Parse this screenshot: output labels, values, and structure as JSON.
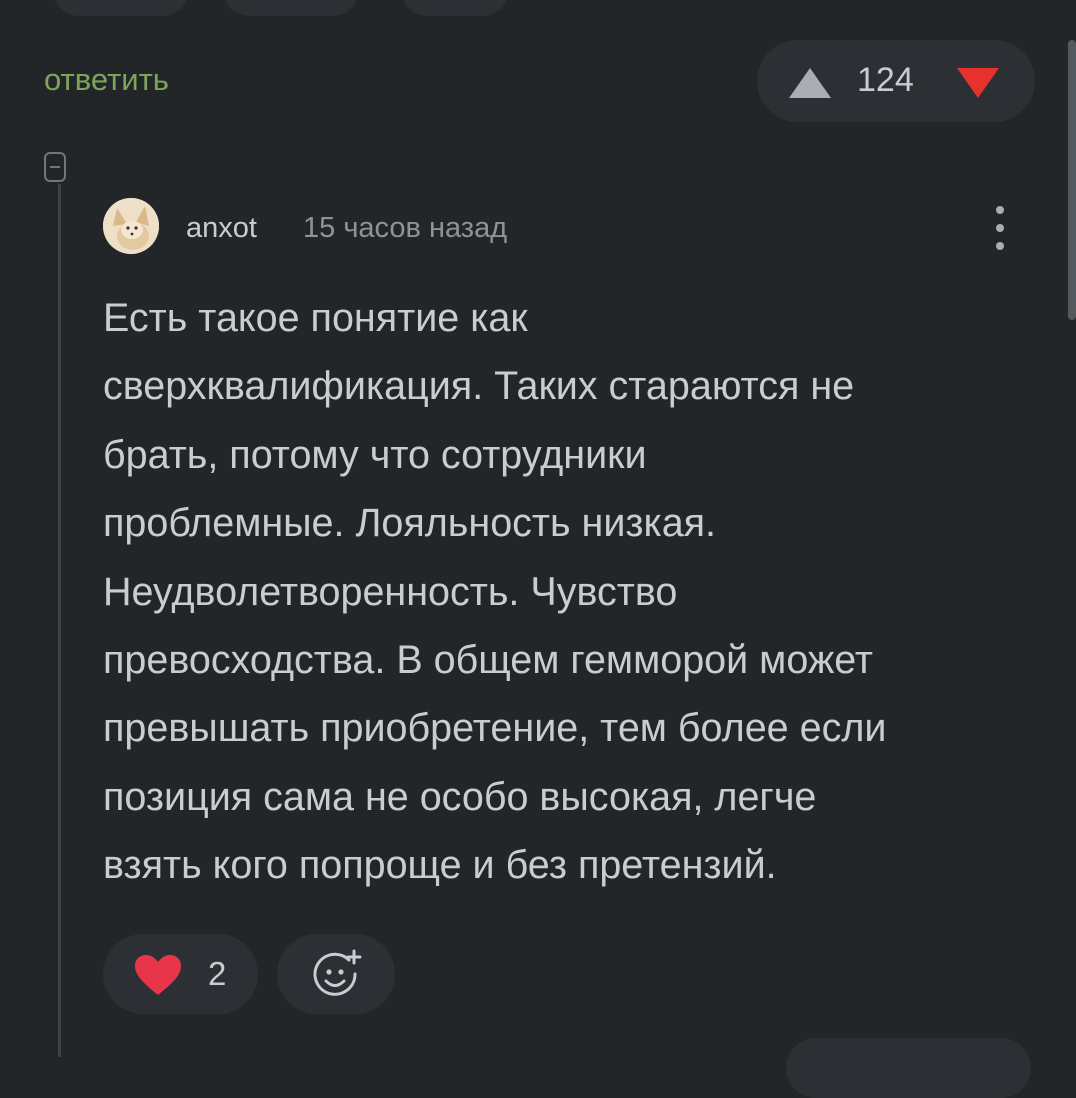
{
  "reply": {
    "label": "ответить"
  },
  "vote": {
    "count": "124"
  },
  "comment": {
    "username": "anxot",
    "time": "15 часов назад",
    "lines": [
      "Есть такое понятие как",
      "сверхквалификация. Таких стараются не",
      "брать, потому что сотрудники",
      "проблемные. Лояльность низкая.",
      "Неудволетворенность. Чувство",
      "превосходства. В общем гемморой может",
      "превышать приобретение, тем более если",
      "позиция сама не особо высокая, легче",
      "взять кого попроще и без претензий."
    ]
  },
  "reactions": {
    "likes": "2"
  },
  "colors": {
    "background": "#232629",
    "surface": "#2c3034",
    "text": "#c9cdd1",
    "muted_text": "#8d9399",
    "reply_link": "#7ea45a",
    "downvote": "#e5322d",
    "heart": "#e8354a"
  },
  "icons": [
    "upvote-icon",
    "downvote-icon",
    "collapse-icon",
    "more-icon",
    "heart-icon",
    "add-reaction-icon"
  ]
}
